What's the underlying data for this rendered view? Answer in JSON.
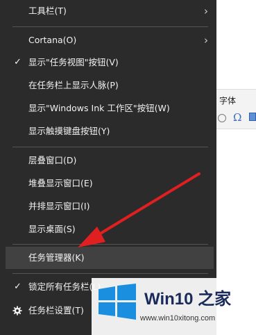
{
  "background_app": {
    "font_label": "字体",
    "omega_glyph": "Ω"
  },
  "menu": {
    "items": [
      {
        "label": "工具栏(T)",
        "has_submenu": true,
        "checked": false
      },
      {
        "label": "Cortana(O)",
        "has_submenu": true,
        "checked": false
      },
      {
        "label": "显示\"任务视图\"按钮(V)",
        "has_submenu": false,
        "checked": true
      },
      {
        "label": "在任务栏上显示人脉(P)",
        "has_submenu": false,
        "checked": false
      },
      {
        "label": "显示\"Windows Ink 工作区\"按钮(W)",
        "has_submenu": false,
        "checked": false
      },
      {
        "label": "显示触摸键盘按钮(Y)",
        "has_submenu": false,
        "checked": false
      },
      {
        "label": "层叠窗口(D)",
        "has_submenu": false,
        "checked": false
      },
      {
        "label": "堆叠显示窗口(E)",
        "has_submenu": false,
        "checked": false
      },
      {
        "label": "并排显示窗口(I)",
        "has_submenu": false,
        "checked": false
      },
      {
        "label": "显示桌面(S)",
        "has_submenu": false,
        "checked": false
      },
      {
        "label": "任务管理器(K)",
        "has_submenu": false,
        "checked": false,
        "highlighted": true
      },
      {
        "label": "锁定所有任务栏(L)",
        "has_submenu": false,
        "checked": true
      },
      {
        "label": "任务栏设置(T)",
        "has_submenu": false,
        "checked": false,
        "icon": "gear-icon"
      }
    ],
    "check_glyph": "✓",
    "submenu_glyph": "›"
  },
  "watermark": {
    "title": "Win10 之家",
    "url": "www.win10xitong.com",
    "logo_color": "#1a8fe0"
  },
  "colors": {
    "menu_bg": "#2b2b2b",
    "menu_highlight": "#414141",
    "arrow": "#e02020"
  }
}
